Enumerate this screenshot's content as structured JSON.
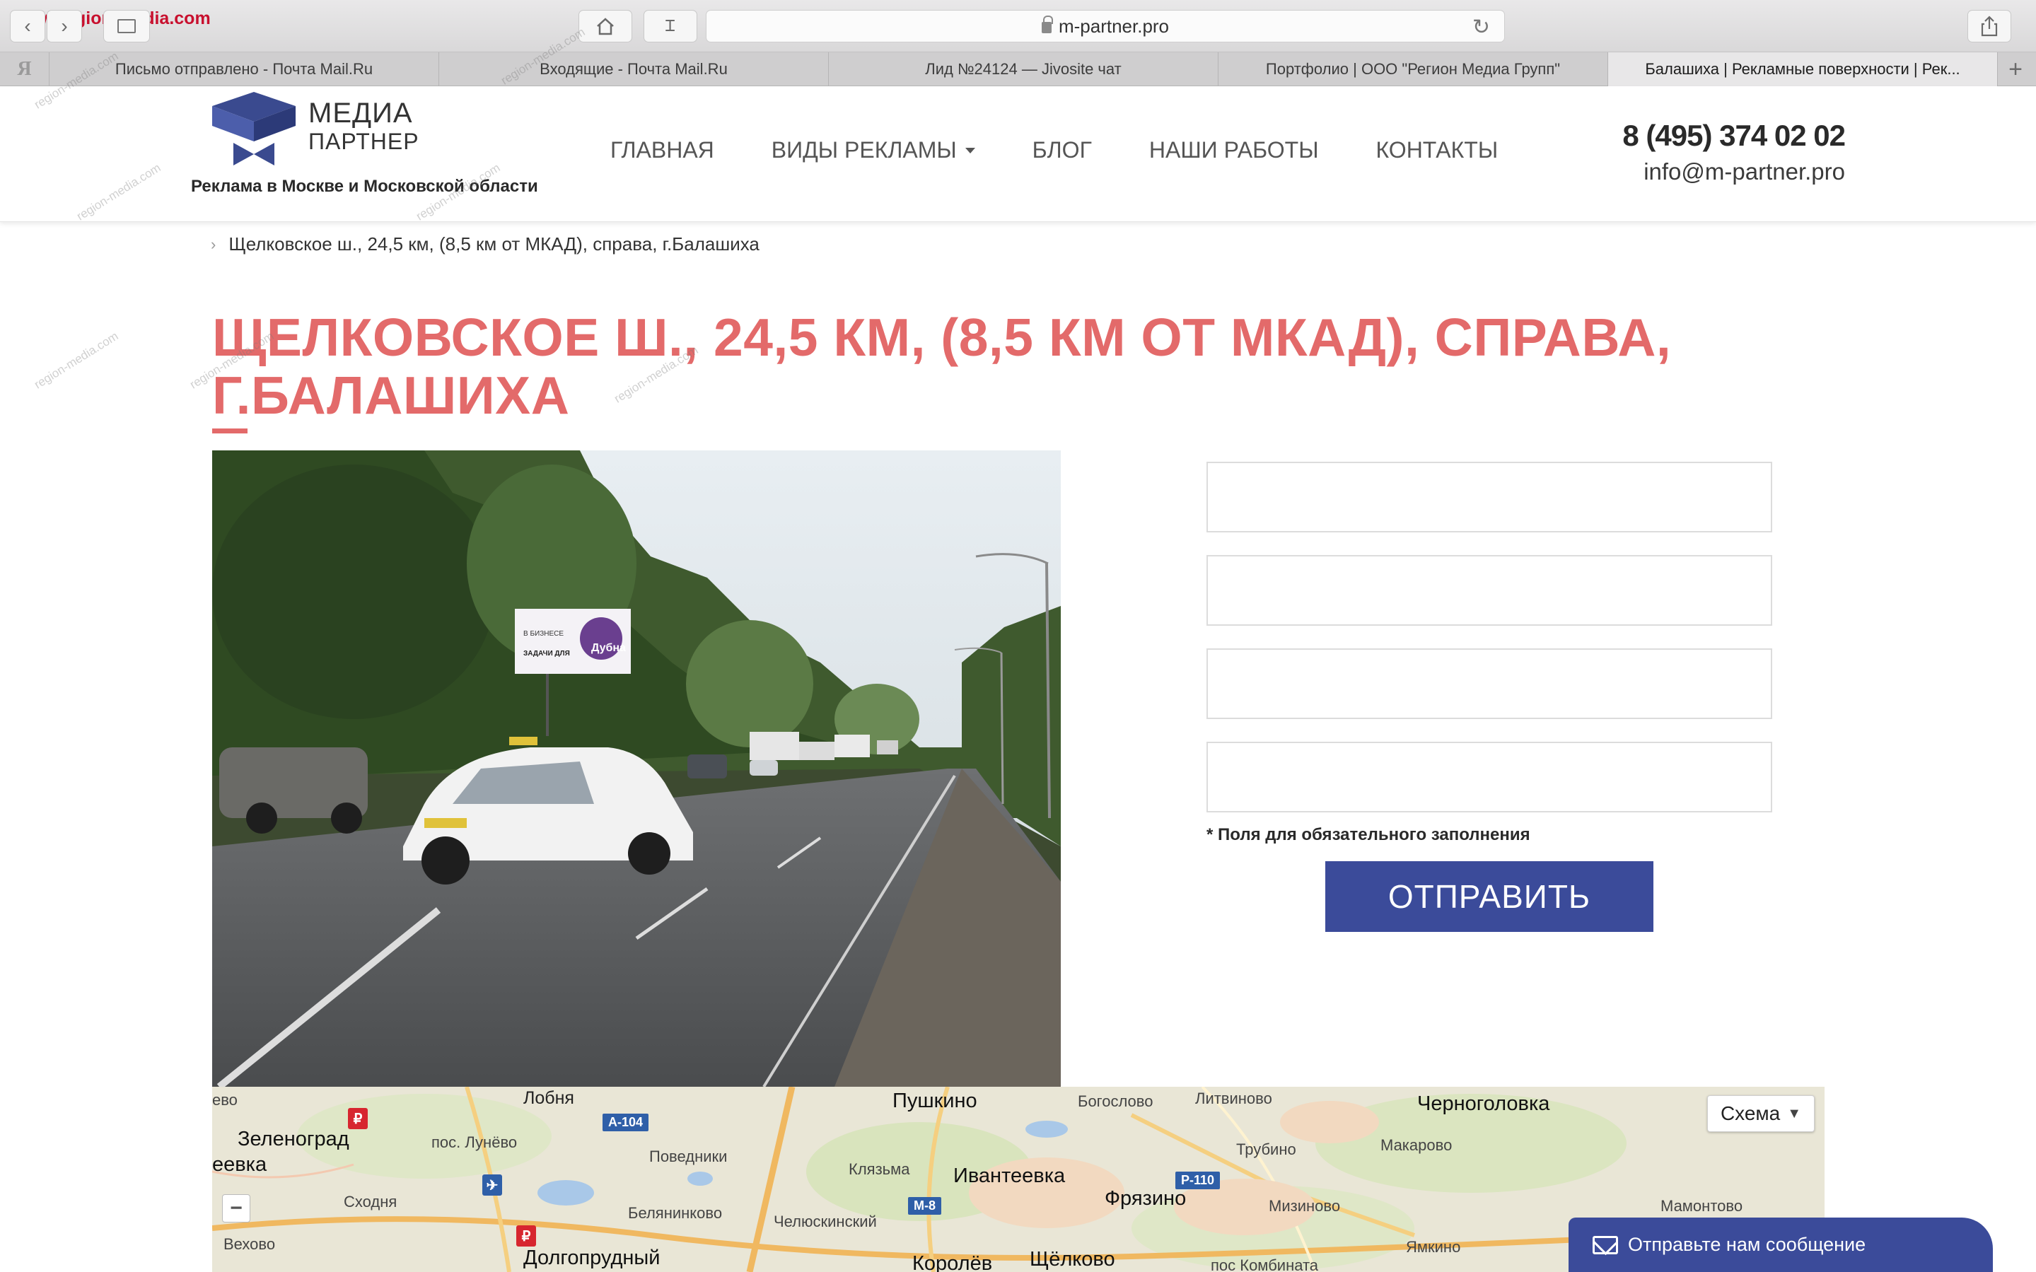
{
  "browser": {
    "watermark_url": "www.region-media.com",
    "address": "m-partner.pro",
    "tabs": [
      {
        "label": "Письмо отправлено - Почта Mail.Ru"
      },
      {
        "label": "Входящие - Почта Mail.Ru"
      },
      {
        "label": "Лид №24124 — Jivosite чат"
      },
      {
        "label": "Портфолио | ООО \"Регион Медиа Групп\""
      },
      {
        "label": "Балашиха | Рекламные поверхности | Рек..."
      }
    ],
    "tab_ya": "Я"
  },
  "header": {
    "logo_line1": "МЕДИА",
    "logo_line2": "ПАРТНЕР",
    "tagline": "Реклама в Москве и Московской области",
    "nav": [
      {
        "label": "ГЛАВНАЯ"
      },
      {
        "label": "ВИДЫ РЕКЛАМЫ"
      },
      {
        "label": "БЛОГ"
      },
      {
        "label": "НАШИ РАБОТЫ"
      },
      {
        "label": "КОНТАКТЫ"
      }
    ],
    "phone": "8 (495) 374 02 02",
    "email": "info@m-partner.pro"
  },
  "breadcrumb": {
    "current": "Щелковское ш., 24,5 км, (8,5 км от МКАД), справа, г.Балашиха"
  },
  "page": {
    "title": "ЩЕЛКОВСКОЕ Ш., 24,5 КМ, (8,5 КМ ОТ МКАД), СПРАВА, Г.БАЛАШИХА"
  },
  "photo": {
    "billboard_text1": "В БИЗНЕСЕ ДОЛЖНЫ БЫТЬ ЗАДАЧИ ДЛЯ ИННОВАЦИЙ",
    "billboard_text2": "Дубна"
  },
  "form": {
    "required_note": "* Поля для обязательного заполнения",
    "submit_label": "ОТПРАВИТЬ"
  },
  "map": {
    "scheme_label": "Схема",
    "labels": [
      "Лобня",
      "Пушкино",
      "Богослово",
      "Литвиново",
      "Черноголовка",
      "Зеленоград",
      "пос. Лунёво",
      "Трубино",
      "Макарово",
      "Поведники",
      "Клязьма",
      "Ивантеевка",
      "Фрязино",
      "Сходня",
      "Белянинково",
      "Челюскинский",
      "Мизиново",
      "Мамонтово",
      "Долгопрудный",
      "Королёв",
      "Щёлково",
      "Ямкино",
      "ево",
      "еевка",
      "Вехово",
      "пос Комбината"
    ],
    "shields": [
      "A-104",
      "M-8",
      "P-110"
    ]
  },
  "chat": {
    "label": "Отправьте нам сообщение"
  },
  "watermark": "region-media.com",
  "colors": {
    "accent_red": "#e36a6a",
    "brand_blue": "#3b4b9a"
  }
}
